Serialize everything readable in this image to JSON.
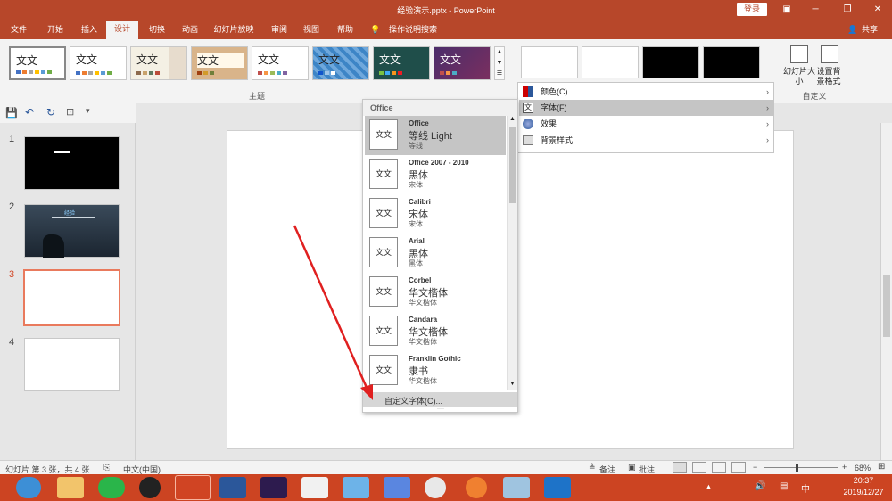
{
  "window": {
    "title": "经验演示.pptx  -  PowerPoint",
    "login_label": "登录",
    "share_label": "共享"
  },
  "tabs": [
    "文件",
    "开始",
    "插入",
    "设计",
    "切换",
    "动画",
    "幻灯片放映",
    "审阅",
    "视图",
    "帮助"
  ],
  "active_tab": "设计",
  "tell_me": "操作说明搜索",
  "themes": {
    "sample_text": "文文",
    "group_label": "主题",
    "items": [
      "Office 主题",
      "主题2",
      "主题3",
      "主题4",
      "主题5",
      "主题6",
      "主题7",
      "主题8"
    ]
  },
  "customize": {
    "slide_size_label": "幻灯片大小",
    "format_bg_label": "设置背景格式",
    "group_label": "自定义"
  },
  "variants_menu": {
    "items": [
      {
        "label": "颜色(C)",
        "icon": "color-palette-icon"
      },
      {
        "label": "字体(F)",
        "icon": "font-icon"
      },
      {
        "label": "效果",
        "icon": "effects-icon"
      },
      {
        "label": "背景样式",
        "icon": "background-icon"
      }
    ]
  },
  "font_dropdown": {
    "header": "Office",
    "sample": "文文",
    "items": [
      {
        "name": "Office",
        "heading": "等线 Light",
        "body": "等线"
      },
      {
        "name": "Office 2007 - 2010",
        "heading": "黑体",
        "body": "宋体"
      },
      {
        "name": "Calibri",
        "heading": "宋体",
        "body": "宋体"
      },
      {
        "name": "Arial",
        "heading": "黑体",
        "body": "黑体"
      },
      {
        "name": "Corbel",
        "heading": "华文楷体",
        "body": "华文楷体"
      },
      {
        "name": "Candara",
        "heading": "华文楷体",
        "body": "华文楷体"
      },
      {
        "name": "Franklin Gothic",
        "heading": "隶书",
        "body": "华文楷体"
      }
    ],
    "custom_label": "自定义字体(C)..."
  },
  "slides": {
    "numbers": [
      "1",
      "2",
      "3",
      "4"
    ],
    "slide2_title": "经验"
  },
  "statusbar": {
    "slide_info": "幻灯片 第 3 张，共 4 张",
    "language": "中文(中国)",
    "notes_label": "备注",
    "comments_label": "批注",
    "zoom": "68%"
  },
  "taskbar": {
    "time": "20:37",
    "date": "2019/12/27",
    "ime": "中"
  },
  "colors": {
    "accent": "#b7472a",
    "taskbar": "#cc4422",
    "selection": "#e97a5d"
  }
}
